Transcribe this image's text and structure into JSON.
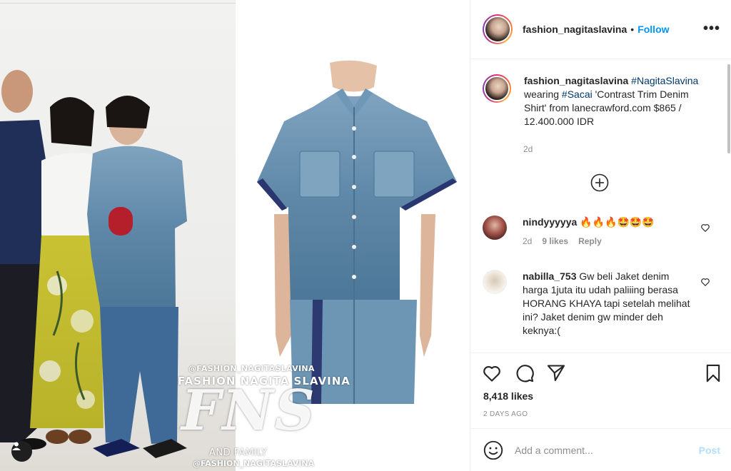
{
  "post": {
    "username": "fashion_nagitaslavina",
    "follow_label": "Follow",
    "more_label": "•••",
    "separator": "•"
  },
  "caption": {
    "username": "fashion_nagitaslavina",
    "hashtag_1": "#NagitaSlavina",
    "text_1": "wearing",
    "hashtag_2": "#Sacai",
    "text_2": "'Contrast Trim Denim Shirt' from lanecrawford.com $865 / 12.400.000 IDR",
    "time": "2d"
  },
  "comments": [
    {
      "username": "nindyyyyya",
      "text": "🔥🔥🔥🤩🤩🤩",
      "time": "2d",
      "likes": "9 likes",
      "reply": "Reply"
    },
    {
      "username": "nabilla_753",
      "text": "Gw beli Jaket denim harga 1juta itu udah paliiing berasa HORANG KHAYA tapi setelah melihat ini? Jaket denim gw minder deh keknya:("
    }
  ],
  "stats": {
    "likes": "8,418 likes",
    "date": "2 DAYS AGO"
  },
  "composer": {
    "placeholder": "Add a comment...",
    "post_label": "Post"
  },
  "watermark": {
    "handle": "@FASHION_NAGITASLAVINA",
    "brand": "FASHION NAGITA SLAVINA",
    "logo": "FNS",
    "family": "AND FAMILY"
  },
  "icons": {
    "more": "more-options-icon",
    "add": "plus-circle-icon",
    "like": "heart-icon",
    "comment": "comment-bubble-icon",
    "share": "paper-plane-icon",
    "save": "bookmark-icon",
    "emoji": "smiley-icon",
    "tag": "user-tag-icon"
  },
  "colors": {
    "accent": "#0095f6",
    "link": "#00376b",
    "muted": "#8e8e8e",
    "post_disabled": "#b2dffc",
    "denim": "#5b86a6"
  }
}
